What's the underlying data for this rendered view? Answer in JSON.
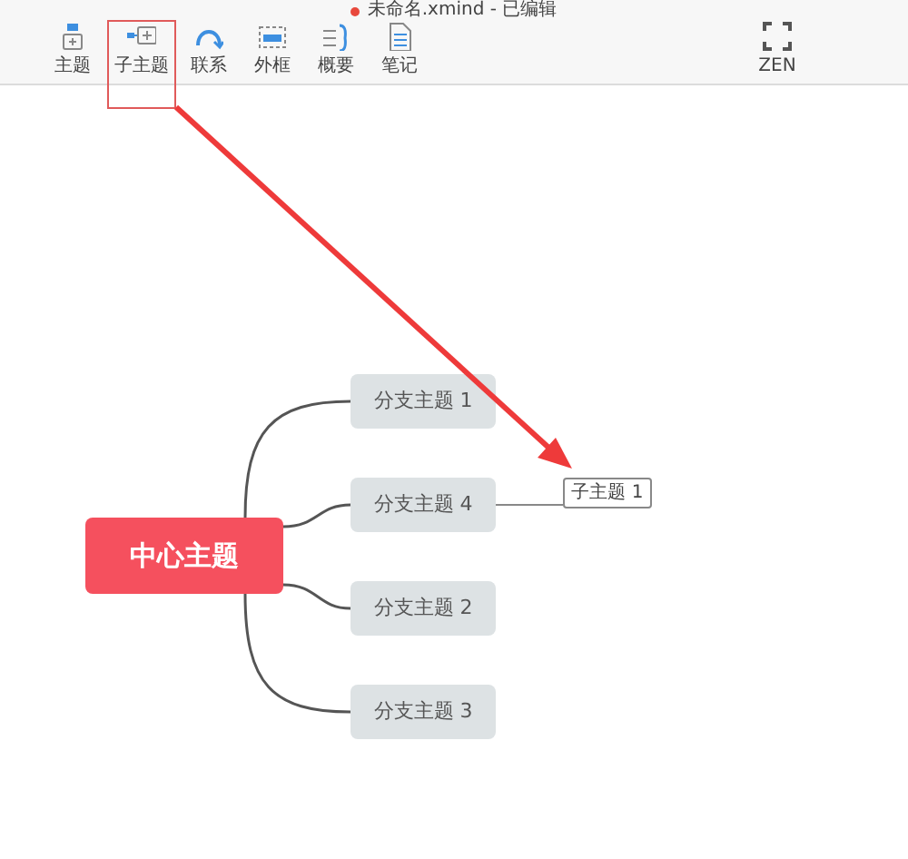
{
  "window": {
    "title": "未命名.xmind - 已编辑",
    "modified": true
  },
  "toolbar": [
    {
      "kind": "topic",
      "label": "主题",
      "highlighted": false
    },
    {
      "kind": "subtopic",
      "label": "子主题",
      "highlighted": true
    },
    {
      "kind": "relation",
      "label": "联系",
      "highlighted": false
    },
    {
      "kind": "boundary",
      "label": "外框",
      "highlighted": false
    },
    {
      "kind": "summary",
      "label": "概要",
      "highlighted": false
    },
    {
      "kind": "note",
      "label": "笔记",
      "highlighted": false
    },
    {
      "kind": "zen",
      "label": "ZEN",
      "highlighted": false
    }
  ],
  "mindmap": {
    "central": "中心主题",
    "branches": [
      {
        "label": "分支主题 1"
      },
      {
        "label": "分支主题 4",
        "children": [
          {
            "label": "子主题 1"
          }
        ]
      },
      {
        "label": "分支主题 2"
      },
      {
        "label": "分支主题 3"
      }
    ]
  }
}
